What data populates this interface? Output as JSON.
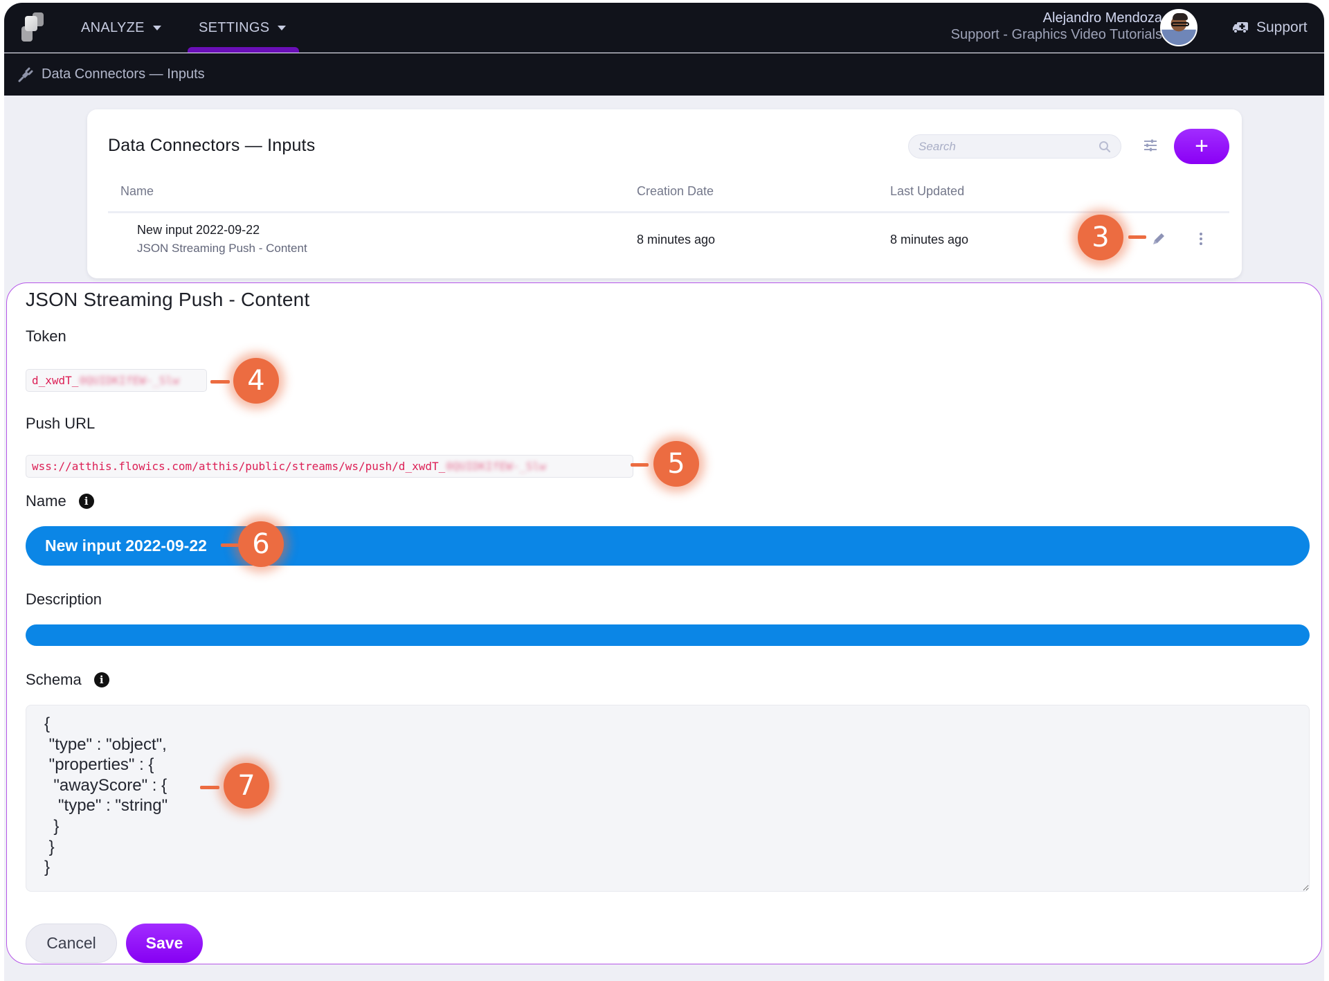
{
  "nav": {
    "items": [
      {
        "label": "ANALYZE",
        "icon": "caret-down-icon"
      },
      {
        "label": "SETTINGS",
        "icon": "caret-down-icon",
        "active": true
      }
    ],
    "user": {
      "name": "Alejandro Mendoza",
      "org": "Support - Graphics Video Tutorials"
    },
    "support_label": "Support",
    "accent": "#6a0fb8"
  },
  "breadcrumb": {
    "icon": "plug-icon",
    "label": "Data Connectors — Inputs"
  },
  "list": {
    "title": "Data Connectors — Inputs",
    "search_placeholder": "Search",
    "add_label": "+",
    "columns": [
      "Name",
      "Creation Date",
      "Last Updated"
    ],
    "rows": [
      {
        "name": "New input 2022-09-22",
        "type": "JSON Streaming Push - Content",
        "created": "8 minutes ago",
        "updated": "8 minutes ago"
      }
    ]
  },
  "form": {
    "title": "JSON Streaming Push - Content",
    "token_label": "Token",
    "token_visible": "d_xwdT_",
    "token_blurred": "0QUIDKIfEW-_Slw",
    "push_url_label": "Push URL",
    "push_url_visible": "wss://atthis.flowics.com/atthis/public/streams/ws/push/d_xwdT_",
    "push_url_blurred": "0QUIDKIfEW-_Slw",
    "name_label": "Name",
    "name_value": "New input 2022-09-22",
    "description_label": "Description",
    "description_value": "",
    "schema_label": "Schema",
    "schema_value": "{\n \"type\" : \"object\",\n \"properties\" : {\n  \"awayScore\" : {\n   \"type\" : \"string\"\n  }\n }\n}",
    "cancel_label": "Cancel",
    "save_label": "Save",
    "field_color": "#0b86e6",
    "save_color": "#8f05f7"
  },
  "annotations": [
    "3",
    "4",
    "5",
    "6",
    "7"
  ],
  "annotation_color": "#ec6c41"
}
